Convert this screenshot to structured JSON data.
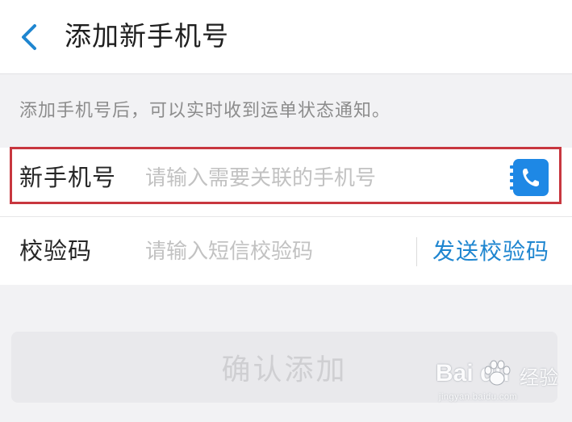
{
  "header": {
    "title": "添加新手机号",
    "back_icon": "chevron-left-icon"
  },
  "hint": "添加手机号后，可以实时收到运单状态通知。",
  "form": {
    "phone": {
      "label": "新手机号",
      "placeholder": "请输入需要关联的手机号",
      "value": "",
      "contact_icon": "phone-book-icon"
    },
    "code": {
      "label": "校验码",
      "placeholder": "请输入短信校验码",
      "value": "",
      "send_label": "发送校验码"
    }
  },
  "confirm_label": "确认添加",
  "watermark": {
    "brand": "Bai du",
    "suffix": "经验",
    "url": "jingyan.baidu.com"
  },
  "colors": {
    "accent": "#1f86d0",
    "highlight_border": "#c8373f",
    "button_disabled_bg": "#e9e9ec",
    "button_disabled_text": "#cfcfd2"
  }
}
